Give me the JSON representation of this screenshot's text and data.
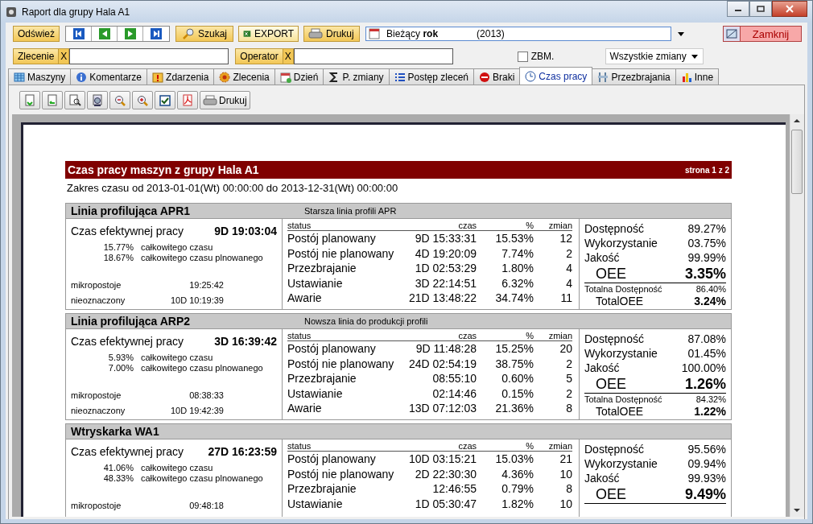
{
  "window": {
    "title": "Raport dla grupy  Hala A1"
  },
  "toolbar": {
    "refresh": "Odśwież",
    "search": "Szukaj",
    "export": "EXPORT",
    "print": "Drukuj",
    "period": {
      "label": "Bieżący **rok**",
      "year": "(2013)"
    },
    "close": "Zamknij"
  },
  "filters": [
    {
      "label": "Zlecenie",
      "clear": "X"
    },
    {
      "label": "Operator",
      "clear": "X"
    }
  ],
  "zbm": {
    "label": "ZBM.",
    "checked": false
  },
  "shift_select": {
    "value": "Wszystkie zmiany"
  },
  "tabs": [
    {
      "label": "Maszyny",
      "selected": false
    },
    {
      "label": "Komentarze",
      "selected": false
    },
    {
      "label": "Zdarzenia",
      "selected": false
    },
    {
      "label": "Zlecenia",
      "selected": false
    },
    {
      "label": "Dzień",
      "selected": false
    },
    {
      "label": "P. zmiany",
      "selected": false
    },
    {
      "label": "Postęp zleceń",
      "selected": false
    },
    {
      "label": "Braki",
      "selected": false
    },
    {
      "label": "Czas pracy",
      "selected": true
    },
    {
      "label": "Przezbrajania",
      "selected": false
    },
    {
      "label": "Inne",
      "selected": false
    }
  ],
  "report_toolbar": {
    "print": "Drukuj"
  },
  "report": {
    "title": "Czas pracy maszyn z grupy Hala A1",
    "page": "strona 1 z 2",
    "range": "Zakres czasu od 2013-01-01(Wt) 00:00:00 do 2013-12-31(Wt) 00:00:00",
    "machines": [
      {
        "name": "Linia profilująca APR1",
        "description": "Starsza linia profili APR",
        "effective_label": "Czas efektywnej pracy",
        "effective_time": "9D 19:03:04",
        "columns": [
          "status",
          "czas",
          "%",
          "zmian"
        ],
        "share_values": [
          "15.77%",
          "18.67%"
        ],
        "share_labels": [
          "całkowitego czasu",
          "całkowitego czasu plnowanego"
        ],
        "extras": [
          {
            "label": "mikropostoje",
            "value": "19:25:42"
          },
          {
            "label": "nieoznaczony",
            "value": "10D 10:19:39"
          }
        ],
        "statuses": [
          {
            "name": "Postój planowany",
            "time": "9D 15:33:31",
            "percent": "15.53%",
            "shifts": "12"
          },
          {
            "name": "Postój nie planowany",
            "time": "4D 19:20:09",
            "percent": "7.74%",
            "shifts": "2"
          },
          {
            "name": "Przezbrajanie",
            "time": "1D 02:53:29",
            "percent": "1.80%",
            "shifts": "4"
          },
          {
            "name": "Ustawianie",
            "time": "3D 22:14:51",
            "percent": "6.32%",
            "shifts": "4"
          },
          {
            "name": "Awarie",
            "time": "21D 13:48:22",
            "percent": "34.74%",
            "shifts": "11"
          }
        ],
        "metrics": [
          {
            "label": "Dostępność",
            "value": "89.27%"
          },
          {
            "label": "Wykorzystanie",
            "value": "03.75%"
          },
          {
            "label": "Jakość",
            "value": "99.99%"
          }
        ],
        "oee": {
          "label": "OEE",
          "value": "3.35%"
        },
        "totals": [
          {
            "label": "Totalna Dostępność",
            "value": "86.40%"
          },
          {
            "label": "TotalOEE",
            "value": "3.24%"
          }
        ]
      },
      {
        "name": "Linia profilująca ARP2",
        "description": "Nowsza linia do produkcji profili",
        "effective_label": "Czas efektywnej pracy",
        "effective_time": "3D 16:39:42",
        "columns": [
          "status",
          "czas",
          "%",
          "zmian"
        ],
        "share_values": [
          "5.93%",
          "7.00%"
        ],
        "share_labels": [
          "całkowitego czasu",
          "całkowitego czasu plnowanego"
        ],
        "extras": [
          {
            "label": "mikropostoje",
            "value": "08:38:33"
          },
          {
            "label": "nieoznaczony",
            "value": "10D 19:42:39"
          }
        ],
        "statuses": [
          {
            "name": "Postój planowany",
            "time": "9D 11:48:28",
            "percent": "15.25%",
            "shifts": "20"
          },
          {
            "name": "Postój nie planowany",
            "time": "24D 02:54:19",
            "percent": "38.75%",
            "shifts": "2"
          },
          {
            "name": "Przezbrajanie",
            "time": "08:55:10",
            "percent": "0.60%",
            "shifts": "5"
          },
          {
            "name": "Ustawianie",
            "time": "02:14:46",
            "percent": "0.15%",
            "shifts": "2"
          },
          {
            "name": "Awarie",
            "time": "13D 07:12:03",
            "percent": "21.36%",
            "shifts": "8"
          }
        ],
        "metrics": [
          {
            "label": "Dostępność",
            "value": "87.08%"
          },
          {
            "label": "Wykorzystanie",
            "value": "01.45%"
          },
          {
            "label": "Jakość",
            "value": "100.00%"
          }
        ],
        "oee": {
          "label": "OEE",
          "value": "1.26%"
        },
        "totals": [
          {
            "label": "Totalna Dostępność",
            "value": "84.32%"
          },
          {
            "label": "TotalOEE",
            "value": "1.22%"
          }
        ]
      },
      {
        "name": "Wtryskarka WA1",
        "effective_label": "Czas efektywnej pracy",
        "effective_time": "27D 16:23:59",
        "columns": [
          "status",
          "czas",
          "%",
          "zmian"
        ],
        "share_values": [
          "41.06%",
          "48.33%"
        ],
        "share_labels": [
          "całkowitego czasu",
          "całkowitego czasu plnowanego"
        ],
        "extras": [
          {
            "label": "mikropostoje",
            "value": "09:48:18"
          }
        ],
        "statuses": [
          {
            "name": "Postój planowany",
            "time": "10D 03:15:21",
            "percent": "15.03%",
            "shifts": "21"
          },
          {
            "name": "Postój nie planowany",
            "time": "2D 22:30:30",
            "percent": "4.36%",
            "shifts": "10"
          },
          {
            "name": "Przezbrajanie",
            "time": "12:46:55",
            "percent": "0.79%",
            "shifts": "8"
          },
          {
            "name": "Ustawianie",
            "time": "1D 05:30:47",
            "percent": "1.82%",
            "shifts": "10"
          }
        ],
        "metrics": [
          {
            "label": "Dostępność",
            "value": "95.56%"
          },
          {
            "label": "Wykorzystanie",
            "value": "09.94%"
          },
          {
            "label": "Jakość",
            "value": "99.93%"
          }
        ],
        "oee": {
          "label": "OEE",
          "value": "9.49%"
        }
      }
    ]
  }
}
